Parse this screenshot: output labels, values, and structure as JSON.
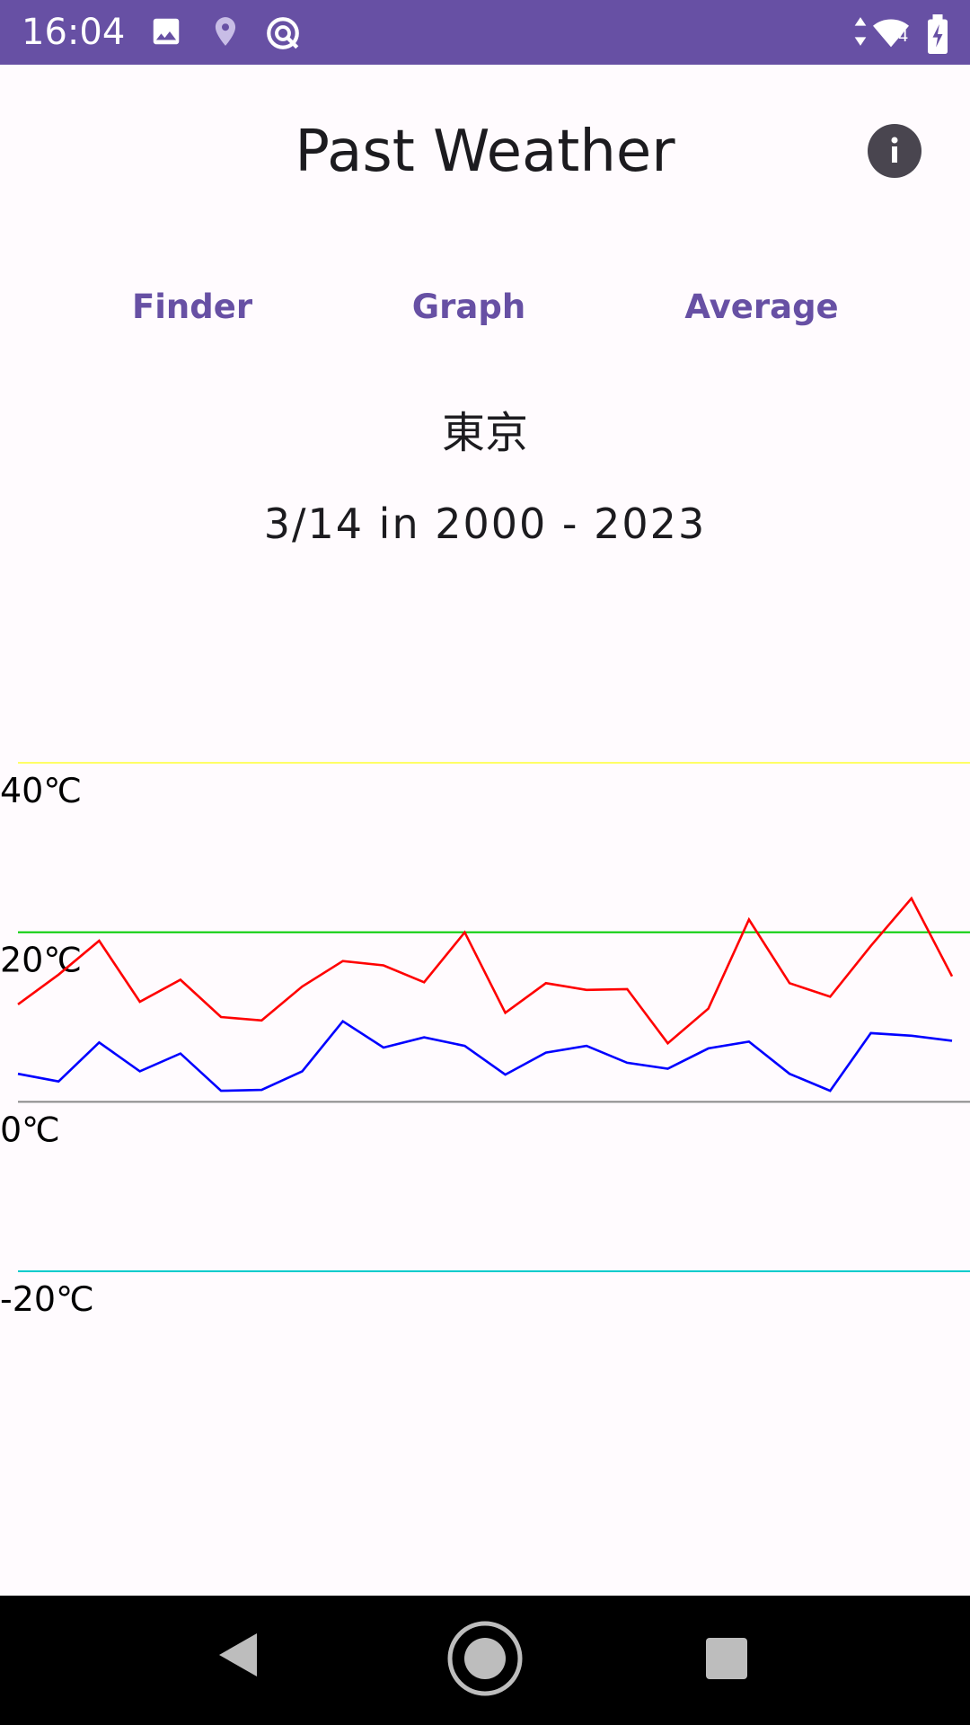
{
  "status_bar": {
    "time": "16:04",
    "icons": [
      "image-icon",
      "location-icon",
      "vpn-icon",
      "data-arrows-icon",
      "wifi-icon",
      "battery-icon"
    ],
    "wifi_badge": "4"
  },
  "header": {
    "title": "Past Weather",
    "info_icon": "info-icon"
  },
  "tabs": [
    {
      "label": "Finder"
    },
    {
      "label": "Graph"
    },
    {
      "label": "Average"
    }
  ],
  "location": "東京",
  "date_range": "3/14 in 2000 - 2023",
  "colors": {
    "accent": "#6750a4",
    "high_series": "#ff0000",
    "low_series": "#0000ff",
    "grid_40": "#ffff66",
    "grid_20": "#00cc00",
    "grid_0": "#888888",
    "grid_neg20": "#00cccc"
  },
  "chart_data": {
    "type": "line",
    "x": [
      2000,
      2001,
      2002,
      2003,
      2004,
      2005,
      2006,
      2007,
      2008,
      2009,
      2010,
      2011,
      2012,
      2013,
      2014,
      2015,
      2016,
      2017,
      2018,
      2019,
      2020,
      2021,
      2022,
      2023
    ],
    "series": [
      {
        "values": [
          11.5,
          15.0,
          19.0,
          11.8,
          14.4,
          10.0,
          9.6,
          13.6,
          16.6,
          16.1,
          14.1,
          20.0,
          10.5,
          14.0,
          13.2,
          13.3,
          6.9,
          11.0,
          21.5,
          14.0,
          12.4,
          18.4,
          24.0,
          14.8
        ]
      },
      {
        "values": [
          3.3,
          2.4,
          7.0,
          3.6,
          5.7,
          1.3,
          1.4,
          3.6,
          9.5,
          6.4,
          7.6,
          6.6,
          3.2,
          5.8,
          6.6,
          4.6,
          3.9,
          6.3,
          7.1,
          3.3,
          1.3,
          8.1,
          7.8,
          7.2
        ]
      }
    ],
    "y_ticks": [
      {
        "value": 40,
        "label": "40℃"
      },
      {
        "value": 20,
        "label": "20℃"
      },
      {
        "value": 0,
        "label": "0℃"
      },
      {
        "value": -20,
        "label": "-20℃"
      }
    ],
    "ylim": [
      -20,
      40
    ],
    "grid": true
  },
  "nav_bar": {
    "icons": [
      "back-icon",
      "home-icon",
      "recents-icon"
    ]
  }
}
